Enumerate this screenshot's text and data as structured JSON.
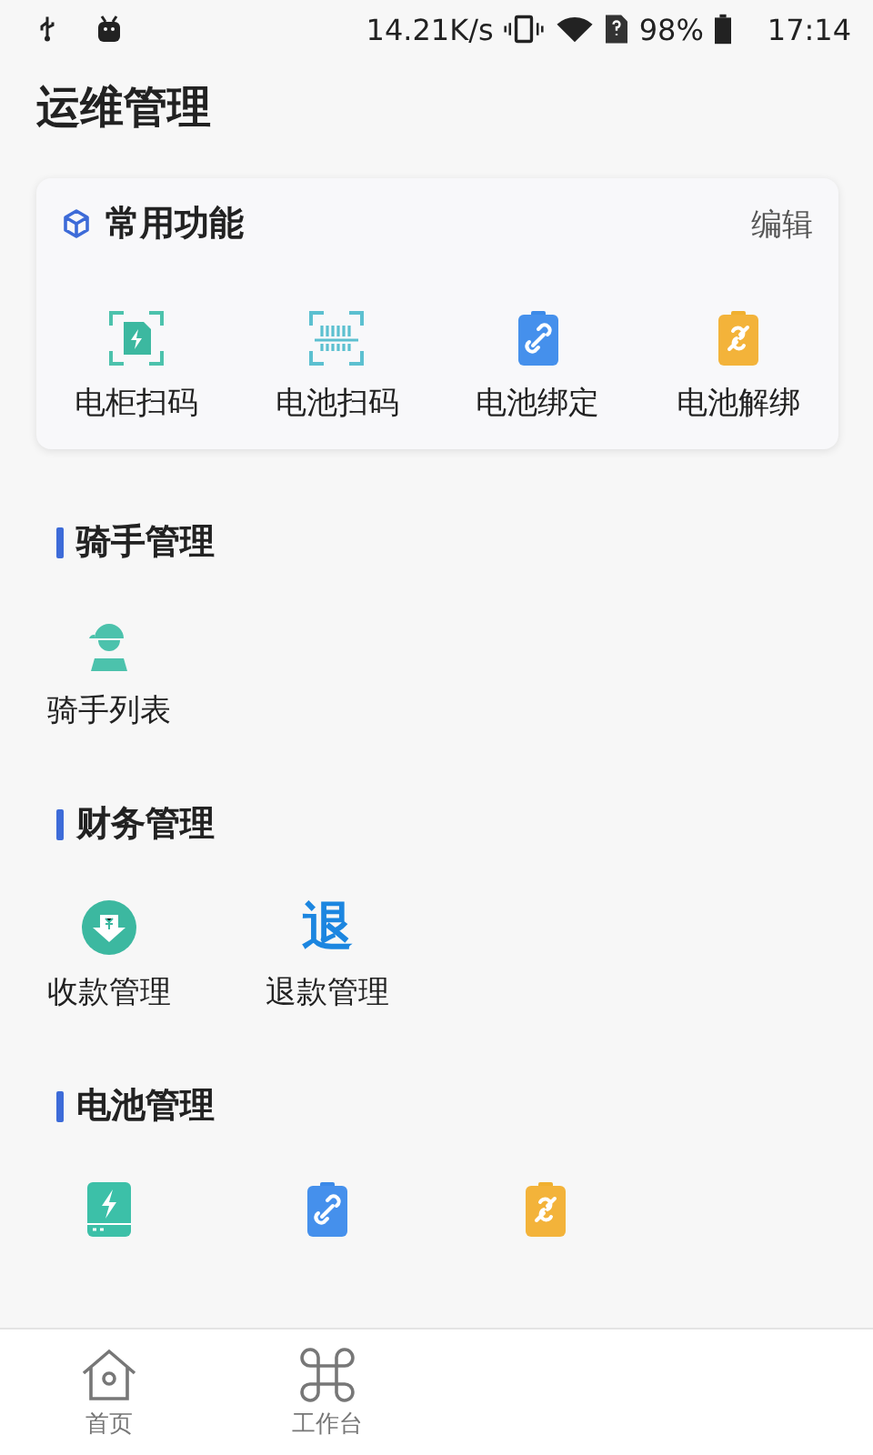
{
  "status_bar": {
    "speed": "14.21K/s",
    "battery": "98%",
    "time": "17:14"
  },
  "title": "运维管理",
  "favorites": {
    "title": "常用功能",
    "edit": "编辑",
    "items": [
      {
        "kind": "cabinet-scan",
        "label": "电柜扫码"
      },
      {
        "kind": "battery-scan",
        "label": "电池扫码"
      },
      {
        "kind": "bind",
        "label": "电池绑定"
      },
      {
        "kind": "unbind",
        "label": "电池解绑"
      }
    ]
  },
  "sections": [
    {
      "title": "骑手管理",
      "items": [
        {
          "kind": "rider",
          "label": "骑手列表"
        }
      ]
    },
    {
      "title": "财务管理",
      "items": [
        {
          "kind": "receive",
          "label": "收款管理"
        },
        {
          "kind": "glyph",
          "glyph": "退",
          "label": "退款管理"
        }
      ]
    },
    {
      "title": "电池管理",
      "items": [
        {
          "kind": "battery"
        },
        {
          "kind": "bind"
        },
        {
          "kind": "unbind"
        }
      ]
    }
  ],
  "tabs": [
    {
      "label": "首页",
      "kind": "home",
      "selected": false
    },
    {
      "label": "工作台",
      "kind": "workbench",
      "selected": false
    }
  ]
}
